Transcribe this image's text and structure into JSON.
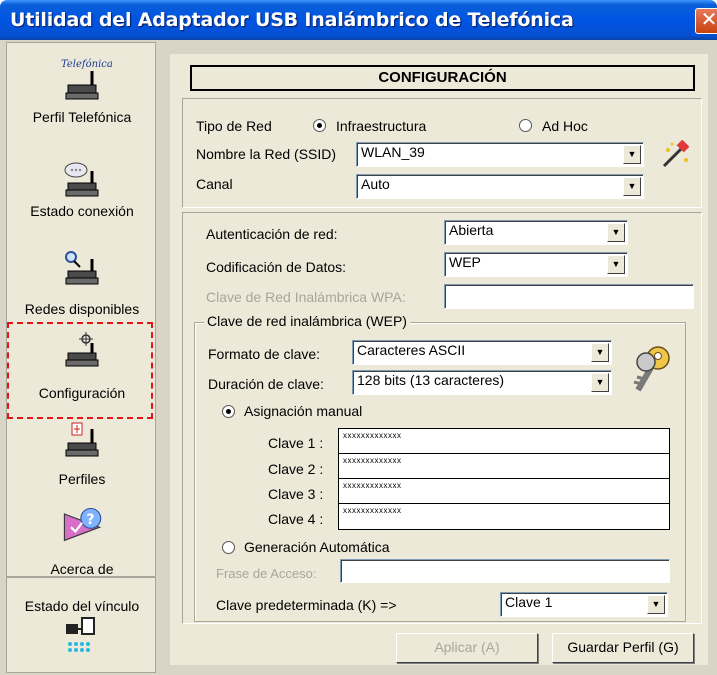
{
  "window": {
    "title": "Utilidad del Adaptador USB Inalámbrico de Telefónica",
    "close_glyph": "✕"
  },
  "sidebar": {
    "brand": "Telefónica",
    "items": [
      {
        "label": "Perfil Telefónica",
        "icon": "router-icon"
      },
      {
        "label": "Estado conexión",
        "icon": "router-speech-icon"
      },
      {
        "label": "Redes disponibles",
        "icon": "router-search-icon"
      },
      {
        "label": "Configuración",
        "icon": "router-config-icon"
      },
      {
        "label": "Perfiles",
        "icon": "router-profiles-icon"
      },
      {
        "label": "Acerca de",
        "icon": "about-icon"
      }
    ],
    "link_status_label": "Estado del vínculo",
    "highlight_color": "#e01515"
  },
  "main": {
    "header": "CONFIGURACIÓN",
    "network_type": {
      "label": "Tipo de Red",
      "options": [
        {
          "label": "Infraestructura",
          "selected": true
        },
        {
          "label": "Ad Hoc",
          "selected": false
        }
      ]
    },
    "network_name": {
      "label": "Nombre la Red (SSID)",
      "value": "WLAN_39"
    },
    "channel": {
      "label": "Canal",
      "value": "Auto"
    },
    "auth": {
      "label": "Autenticación de red:",
      "value": "Abierta"
    },
    "encoding": {
      "label": "Codificación de Datos:",
      "value": "WEP"
    },
    "wpa_key": {
      "label": "Clave de Red Inalámbrica WPA:",
      "value": ""
    },
    "wep": {
      "group_label": "Clave de red inalámbrica (WEP)",
      "format": {
        "label": "Formato de clave:",
        "value": "Caracteres ASCII"
      },
      "duration": {
        "label": "Duración de clave:",
        "value": "128 bits (13 caracteres)"
      },
      "manual": {
        "label": "Asignación manual",
        "selected": true
      },
      "keys": [
        {
          "label": "Clave 1 :",
          "value": "xxxxxxxxxxxxx"
        },
        {
          "label": "Clave 2 :",
          "value": "xxxxxxxxxxxxx"
        },
        {
          "label": "Clave 3 :",
          "value": "xxxxxxxxxxxxx"
        },
        {
          "label": "Clave 4 :",
          "value": "xxxxxxxxxxxxx"
        }
      ],
      "auto": {
        "label": "Generación Automática",
        "selected": false
      },
      "passphrase": {
        "label": "Frase de Acceso:",
        "value": ""
      },
      "default_key": {
        "label": "Clave predeterminada (K) =>",
        "value": "Clave 1"
      }
    },
    "buttons": {
      "apply": "Aplicar (A)",
      "save": "Guardar Perfil (G)"
    }
  }
}
